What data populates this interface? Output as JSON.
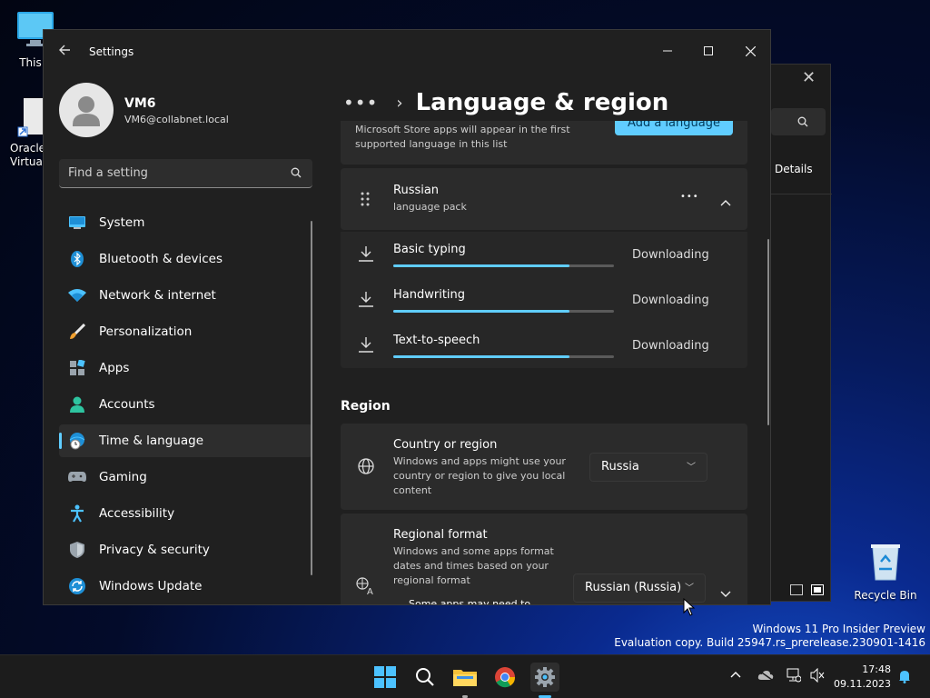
{
  "desktop": {
    "icons": [
      {
        "label": "This P"
      },
      {
        "label": "Oracle\nVirtuall"
      },
      {
        "label": "Recycle Bin"
      }
    ],
    "watermark_line1": "Windows 11 Pro Insider Preview",
    "watermark_line2": "Evaluation copy. Build 25947.rs_prerelease.230901-1416"
  },
  "background_window": {
    "details_label": "Details"
  },
  "window": {
    "title": "Settings"
  },
  "profile": {
    "name": "VM6",
    "email": "VM6@collabnet.local"
  },
  "search": {
    "placeholder": "Find a setting"
  },
  "sidebar": {
    "items": [
      {
        "label": "System",
        "icon": "monitor-icon"
      },
      {
        "label": "Bluetooth & devices",
        "icon": "bluetooth-icon"
      },
      {
        "label": "Network & internet",
        "icon": "wifi-icon"
      },
      {
        "label": "Personalization",
        "icon": "brush-icon"
      },
      {
        "label": "Apps",
        "icon": "apps-icon"
      },
      {
        "label": "Accounts",
        "icon": "person-icon"
      },
      {
        "label": "Time & language",
        "icon": "globe-clock-icon",
        "active": true
      },
      {
        "label": "Gaming",
        "icon": "gamepad-icon"
      },
      {
        "label": "Accessibility",
        "icon": "accessibility-icon"
      },
      {
        "label": "Privacy & security",
        "icon": "shield-icon"
      },
      {
        "label": "Windows Update",
        "icon": "update-icon"
      }
    ]
  },
  "page": {
    "breadcrumb_dots": "•••",
    "title": "Language & region"
  },
  "languages": {
    "info_text": "Microsoft Store apps will appear in the first supported language in this list",
    "add_button": "Add a language",
    "language": {
      "name": "Russian",
      "subtitle": "language pack",
      "more": "•••"
    },
    "features": [
      {
        "label": "Basic typing",
        "status": "Downloading",
        "progress": 0.8
      },
      {
        "label": "Handwriting",
        "status": "Downloading",
        "progress": 0.8
      },
      {
        "label": "Text-to-speech",
        "status": "Downloading",
        "progress": 0.8
      }
    ]
  },
  "region": {
    "heading": "Region",
    "country": {
      "title": "Country or region",
      "desc": "Windows and apps might use your country or region to give you local content",
      "value": "Russia"
    },
    "format": {
      "title": "Regional format",
      "desc": "Windows and some apps format dates and times based on your regional format",
      "value": "Russian (Russia)",
      "tooltip": "Some apps may need to"
    }
  },
  "taskbar": {
    "time": "17:48",
    "date": "09.11.2023"
  }
}
